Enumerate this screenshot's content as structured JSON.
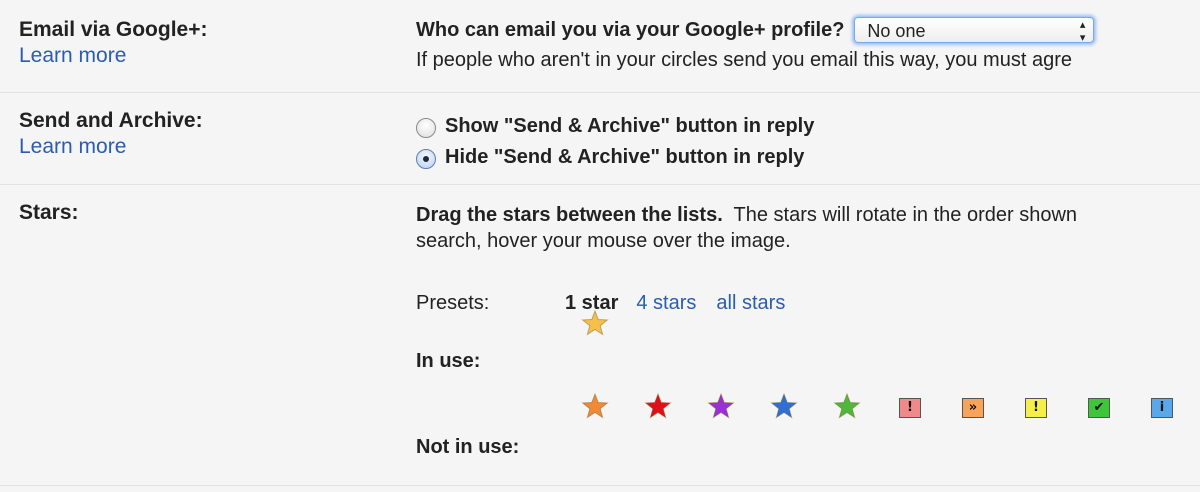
{
  "email_gplus": {
    "title": "Email via Google+:",
    "learn_more": "Learn more",
    "question": "Who can email you via your Google+ profile?",
    "select_value": "No one",
    "description": "If people who aren't in your circles send you email this way, you must agre"
  },
  "send_archive": {
    "title": "Send and Archive:",
    "learn_more": "Learn more",
    "option_show": "Show \"Send & Archive\" button in reply",
    "option_hide": "Hide \"Send & Archive\" button in reply",
    "selected": "hide"
  },
  "stars": {
    "title": "Stars:",
    "instruction_bold": "Drag the stars between the lists.",
    "instruction_rest": "The stars will rotate in the order shown",
    "instruction_line2": "search, hover your mouse over the image.",
    "presets_label": "Presets:",
    "preset_current": "1 star",
    "preset_4": "4 stars",
    "preset_all": "all stars",
    "in_use_label": "In use:",
    "not_in_use_label": "Not in use:",
    "in_use": [
      {
        "name": "yellow-star-icon",
        "color": "#f5c04a"
      }
    ],
    "not_in_use": [
      {
        "name": "orange-star-icon",
        "kind": "star",
        "color": "#f08a36"
      },
      {
        "name": "red-star-icon",
        "kind": "star",
        "color": "#e0101a"
      },
      {
        "name": "purple-star-icon",
        "kind": "star",
        "color": "#9a2ed8"
      },
      {
        "name": "blue-star-icon",
        "kind": "star",
        "color": "#2f6fd6"
      },
      {
        "name": "green-star-icon",
        "kind": "star",
        "color": "#4fb83a"
      },
      {
        "name": "red-bang-icon",
        "kind": "box",
        "glyph": "!",
        "color": "#f08a8a"
      },
      {
        "name": "orange-guillemet-icon",
        "kind": "box",
        "glyph": "»",
        "color": "#f7a45a"
      },
      {
        "name": "yellow-bang-icon",
        "kind": "box",
        "glyph": "!",
        "color": "#f6ef4a"
      },
      {
        "name": "green-check-icon",
        "kind": "box",
        "glyph": "✔",
        "color": "#3ec63a"
      },
      {
        "name": "blue-info-icon",
        "kind": "box",
        "glyph": "i",
        "color": "#5aa8ec"
      }
    ]
  }
}
